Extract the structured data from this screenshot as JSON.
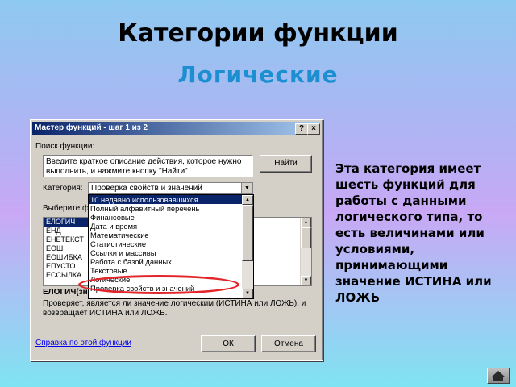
{
  "slide": {
    "title": "Категории функции",
    "subtitle": "Логические",
    "description": "Эта категория имеет шесть функций для работы с данными логического типа, то есть величинами или условиями, принимающими значение ИСТИНА или ЛОЖЬ",
    "subtitle_color": "#1c8fd0"
  },
  "dialog": {
    "title": "Мастер функций - шаг 1 из 2",
    "help_btn": "?",
    "close_btn": "×",
    "search_label": "Поиск функции:",
    "search_value": "Введите краткое описание действия, которое нужно выполнить, и нажмите кнопку \"Найти\"",
    "find_button": "Найти",
    "category_label": "Категория:",
    "category_value": "Проверка свойств и значений",
    "select_label": "Выберите фун",
    "functions": [
      "ЕЛОГИЧ",
      "ЕНД",
      "ЕНЕТЕКСТ",
      "ЕОШ",
      "ЕОШИБКА",
      "ЕПУСТО",
      "ЕССЫЛКА"
    ],
    "selected_function_sig": "ЕЛОГИЧ(зн",
    "function_desc": "Проверяет, является ли значение логическим (ИСТИНА или ЛОЖЬ), и возвращает ИСТИНА или ЛОЖЬ.",
    "help_link": "Справка по этой функции",
    "ok_button": "ОК",
    "cancel_button": "Отмена"
  },
  "dropdown": {
    "items": [
      "10 недавно использовавшихся",
      "Полный алфавитный перечень",
      "Финансовые",
      "Дата и время",
      "Математические",
      "Статистические",
      "Ссылки и массивы",
      "Работа с базой данных",
      "Текстовые",
      "Логические",
      "Проверка свойств и значений"
    ],
    "highlighted_index": 0
  },
  "colors": {
    "titlebar": "#0a246a",
    "highlight_ring": "#e3242b"
  }
}
